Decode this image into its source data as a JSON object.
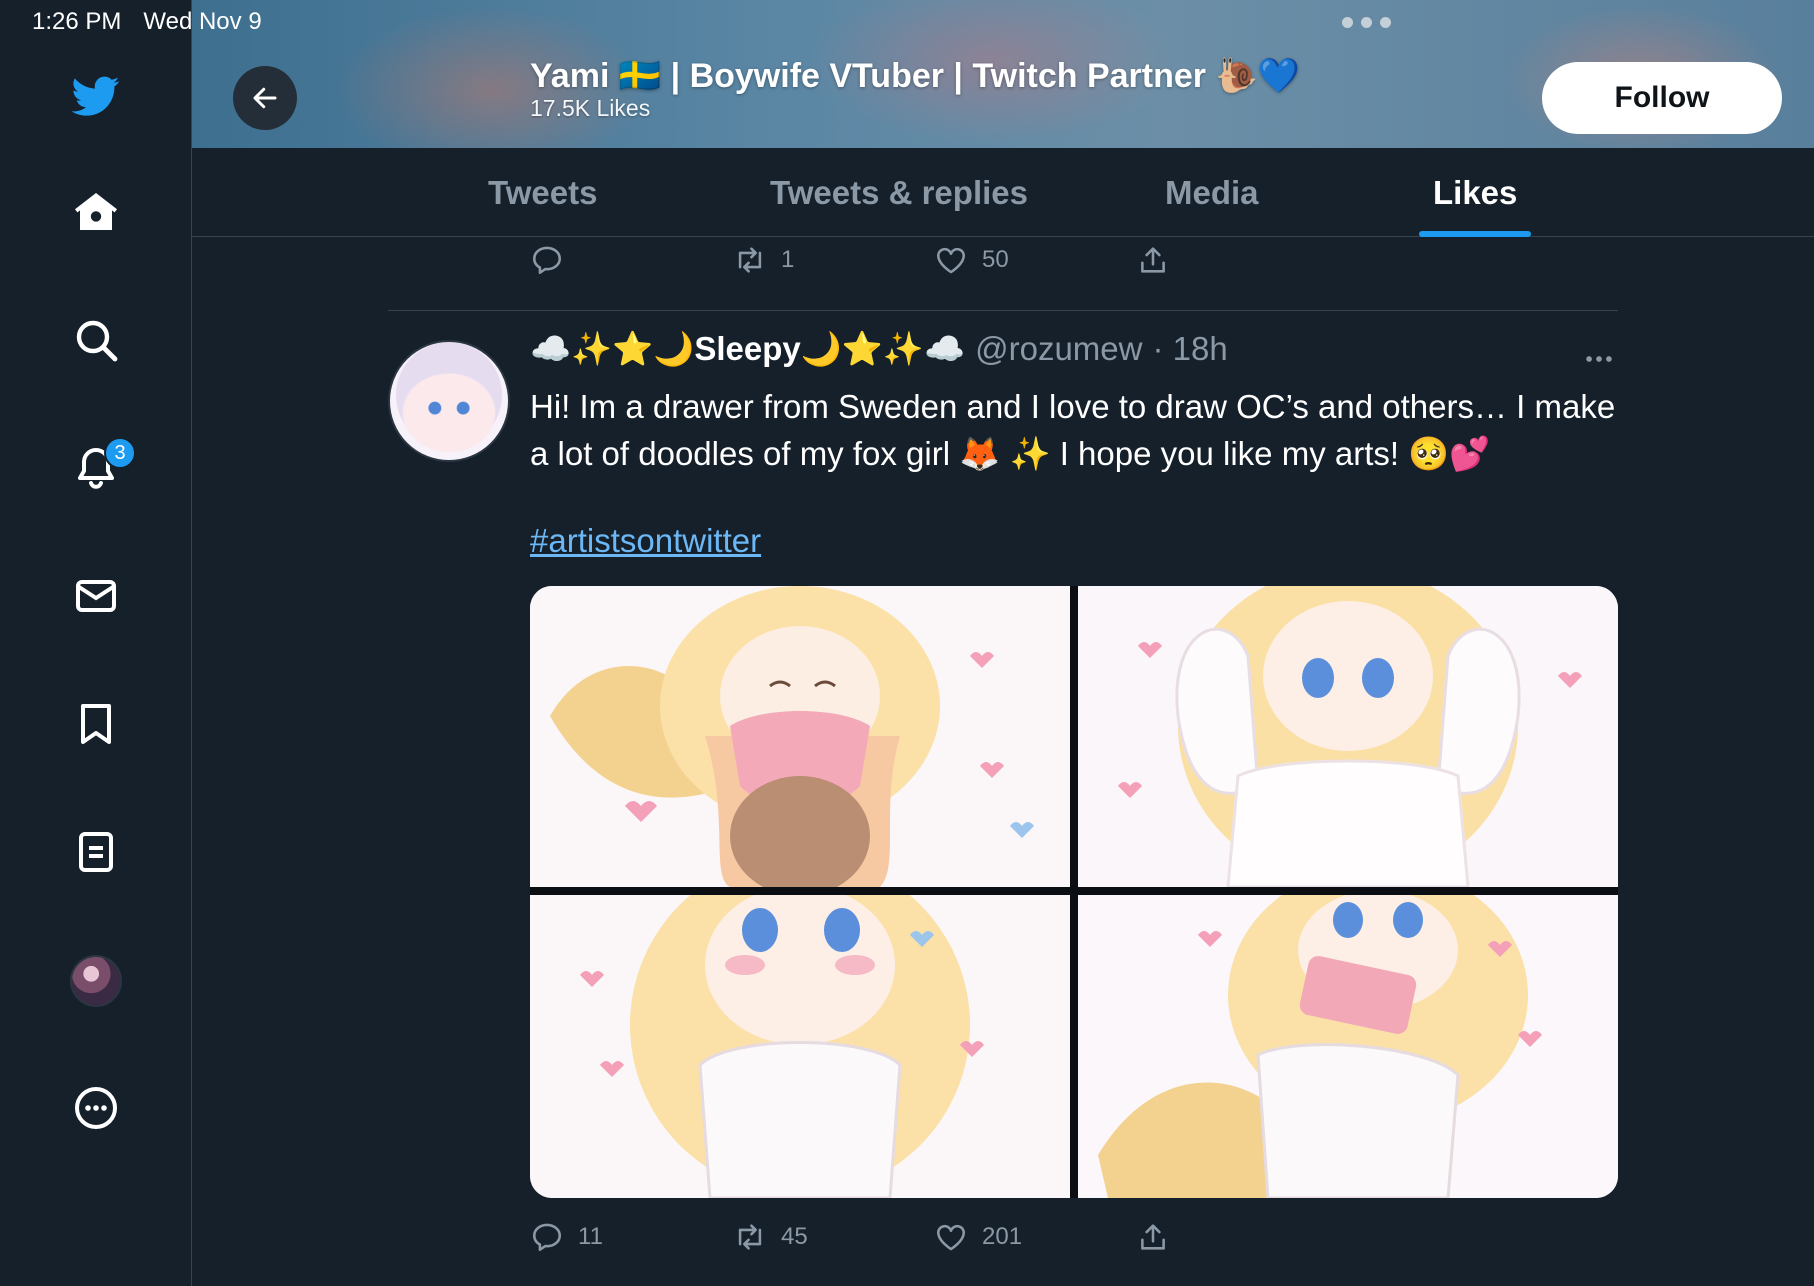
{
  "status_bar": {
    "time": "1:26 PM",
    "date": "Wed Nov 9"
  },
  "sidebar": {
    "items": [
      {
        "name": "twitter-logo",
        "icon": "bird-icon"
      },
      {
        "name": "home",
        "icon": "home-icon"
      },
      {
        "name": "explore",
        "icon": "search-icon"
      },
      {
        "name": "notifications",
        "icon": "bell-icon",
        "badge": "3"
      },
      {
        "name": "messages",
        "icon": "mail-icon"
      },
      {
        "name": "bookmarks",
        "icon": "bookmark-icon"
      },
      {
        "name": "lists",
        "icon": "list-icon"
      },
      {
        "name": "profile",
        "icon": "avatar"
      },
      {
        "name": "more",
        "icon": "more-circle-icon"
      }
    ]
  },
  "header": {
    "name": "Yami 🇸🇪 | Boywife VTuber | Twitch Partner 🐌💙",
    "likes": "17.5K Likes",
    "follow_label": "Follow"
  },
  "tabs": [
    {
      "label": "Tweets",
      "active": false
    },
    {
      "label": "Tweets & replies",
      "active": false
    },
    {
      "label": "Media",
      "active": false
    },
    {
      "label": "Likes",
      "active": true
    }
  ],
  "previous_tweet": {
    "replies": "",
    "retweets": "1",
    "likes": "50"
  },
  "tweet": {
    "display_name": "☁️✨⭐🌙Sleepy🌙⭐✨☁️",
    "handle": "@rozumew",
    "time": "· 18h",
    "text": "Hi! Im a drawer from Sweden and I love to draw OC’s and others… I make a lot of doodles of my fox girl 🦊 ✨ I hope you like my arts! 🥺💕",
    "hashtag": "#artistsontwitter",
    "replies": "11",
    "retweets": "45",
    "likes": "201"
  },
  "colors": {
    "background": "#15202b",
    "accent": "#1d9bf0",
    "muted": "#8b98a5",
    "link": "#6cb7f5",
    "border": "#38444d"
  }
}
